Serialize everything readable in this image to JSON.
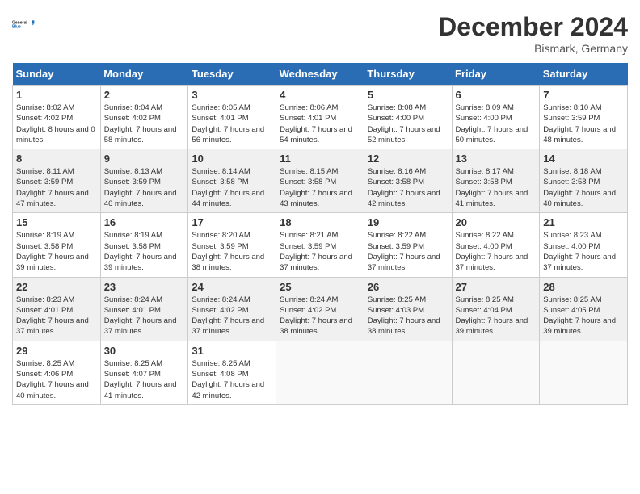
{
  "header": {
    "logo_text_general": "General",
    "logo_text_blue": "Blue",
    "month_title": "December 2024",
    "location": "Bismark, Germany"
  },
  "days_of_week": [
    "Sunday",
    "Monday",
    "Tuesday",
    "Wednesday",
    "Thursday",
    "Friday",
    "Saturday"
  ],
  "weeks": [
    [
      {
        "num": "1",
        "sunrise": "8:02 AM",
        "sunset": "4:02 PM",
        "daylight": "8 hours and 0 minutes."
      },
      {
        "num": "2",
        "sunrise": "8:04 AM",
        "sunset": "4:02 PM",
        "daylight": "7 hours and 58 minutes."
      },
      {
        "num": "3",
        "sunrise": "8:05 AM",
        "sunset": "4:01 PM",
        "daylight": "7 hours and 56 minutes."
      },
      {
        "num": "4",
        "sunrise": "8:06 AM",
        "sunset": "4:01 PM",
        "daylight": "7 hours and 54 minutes."
      },
      {
        "num": "5",
        "sunrise": "8:08 AM",
        "sunset": "4:00 PM",
        "daylight": "7 hours and 52 minutes."
      },
      {
        "num": "6",
        "sunrise": "8:09 AM",
        "sunset": "4:00 PM",
        "daylight": "7 hours and 50 minutes."
      },
      {
        "num": "7",
        "sunrise": "8:10 AM",
        "sunset": "3:59 PM",
        "daylight": "7 hours and 48 minutes."
      }
    ],
    [
      {
        "num": "8",
        "sunrise": "8:11 AM",
        "sunset": "3:59 PM",
        "daylight": "7 hours and 47 minutes."
      },
      {
        "num": "9",
        "sunrise": "8:13 AM",
        "sunset": "3:59 PM",
        "daylight": "7 hours and 46 minutes."
      },
      {
        "num": "10",
        "sunrise": "8:14 AM",
        "sunset": "3:58 PM",
        "daylight": "7 hours and 44 minutes."
      },
      {
        "num": "11",
        "sunrise": "8:15 AM",
        "sunset": "3:58 PM",
        "daylight": "7 hours and 43 minutes."
      },
      {
        "num": "12",
        "sunrise": "8:16 AM",
        "sunset": "3:58 PM",
        "daylight": "7 hours and 42 minutes."
      },
      {
        "num": "13",
        "sunrise": "8:17 AM",
        "sunset": "3:58 PM",
        "daylight": "7 hours and 41 minutes."
      },
      {
        "num": "14",
        "sunrise": "8:18 AM",
        "sunset": "3:58 PM",
        "daylight": "7 hours and 40 minutes."
      }
    ],
    [
      {
        "num": "15",
        "sunrise": "8:19 AM",
        "sunset": "3:58 PM",
        "daylight": "7 hours and 39 minutes."
      },
      {
        "num": "16",
        "sunrise": "8:19 AM",
        "sunset": "3:58 PM",
        "daylight": "7 hours and 39 minutes."
      },
      {
        "num": "17",
        "sunrise": "8:20 AM",
        "sunset": "3:59 PM",
        "daylight": "7 hours and 38 minutes."
      },
      {
        "num": "18",
        "sunrise": "8:21 AM",
        "sunset": "3:59 PM",
        "daylight": "7 hours and 37 minutes."
      },
      {
        "num": "19",
        "sunrise": "8:22 AM",
        "sunset": "3:59 PM",
        "daylight": "7 hours and 37 minutes."
      },
      {
        "num": "20",
        "sunrise": "8:22 AM",
        "sunset": "4:00 PM",
        "daylight": "7 hours and 37 minutes."
      },
      {
        "num": "21",
        "sunrise": "8:23 AM",
        "sunset": "4:00 PM",
        "daylight": "7 hours and 37 minutes."
      }
    ],
    [
      {
        "num": "22",
        "sunrise": "8:23 AM",
        "sunset": "4:01 PM",
        "daylight": "7 hours and 37 minutes."
      },
      {
        "num": "23",
        "sunrise": "8:24 AM",
        "sunset": "4:01 PM",
        "daylight": "7 hours and 37 minutes."
      },
      {
        "num": "24",
        "sunrise": "8:24 AM",
        "sunset": "4:02 PM",
        "daylight": "7 hours and 37 minutes."
      },
      {
        "num": "25",
        "sunrise": "8:24 AM",
        "sunset": "4:02 PM",
        "daylight": "7 hours and 38 minutes."
      },
      {
        "num": "26",
        "sunrise": "8:25 AM",
        "sunset": "4:03 PM",
        "daylight": "7 hours and 38 minutes."
      },
      {
        "num": "27",
        "sunrise": "8:25 AM",
        "sunset": "4:04 PM",
        "daylight": "7 hours and 39 minutes."
      },
      {
        "num": "28",
        "sunrise": "8:25 AM",
        "sunset": "4:05 PM",
        "daylight": "7 hours and 39 minutes."
      }
    ],
    [
      {
        "num": "29",
        "sunrise": "8:25 AM",
        "sunset": "4:06 PM",
        "daylight": "7 hours and 40 minutes."
      },
      {
        "num": "30",
        "sunrise": "8:25 AM",
        "sunset": "4:07 PM",
        "daylight": "7 hours and 41 minutes."
      },
      {
        "num": "31",
        "sunrise": "8:25 AM",
        "sunset": "4:08 PM",
        "daylight": "7 hours and 42 minutes."
      },
      null,
      null,
      null,
      null
    ]
  ],
  "labels": {
    "sunrise": "Sunrise:",
    "sunset": "Sunset:",
    "daylight": "Daylight:"
  }
}
